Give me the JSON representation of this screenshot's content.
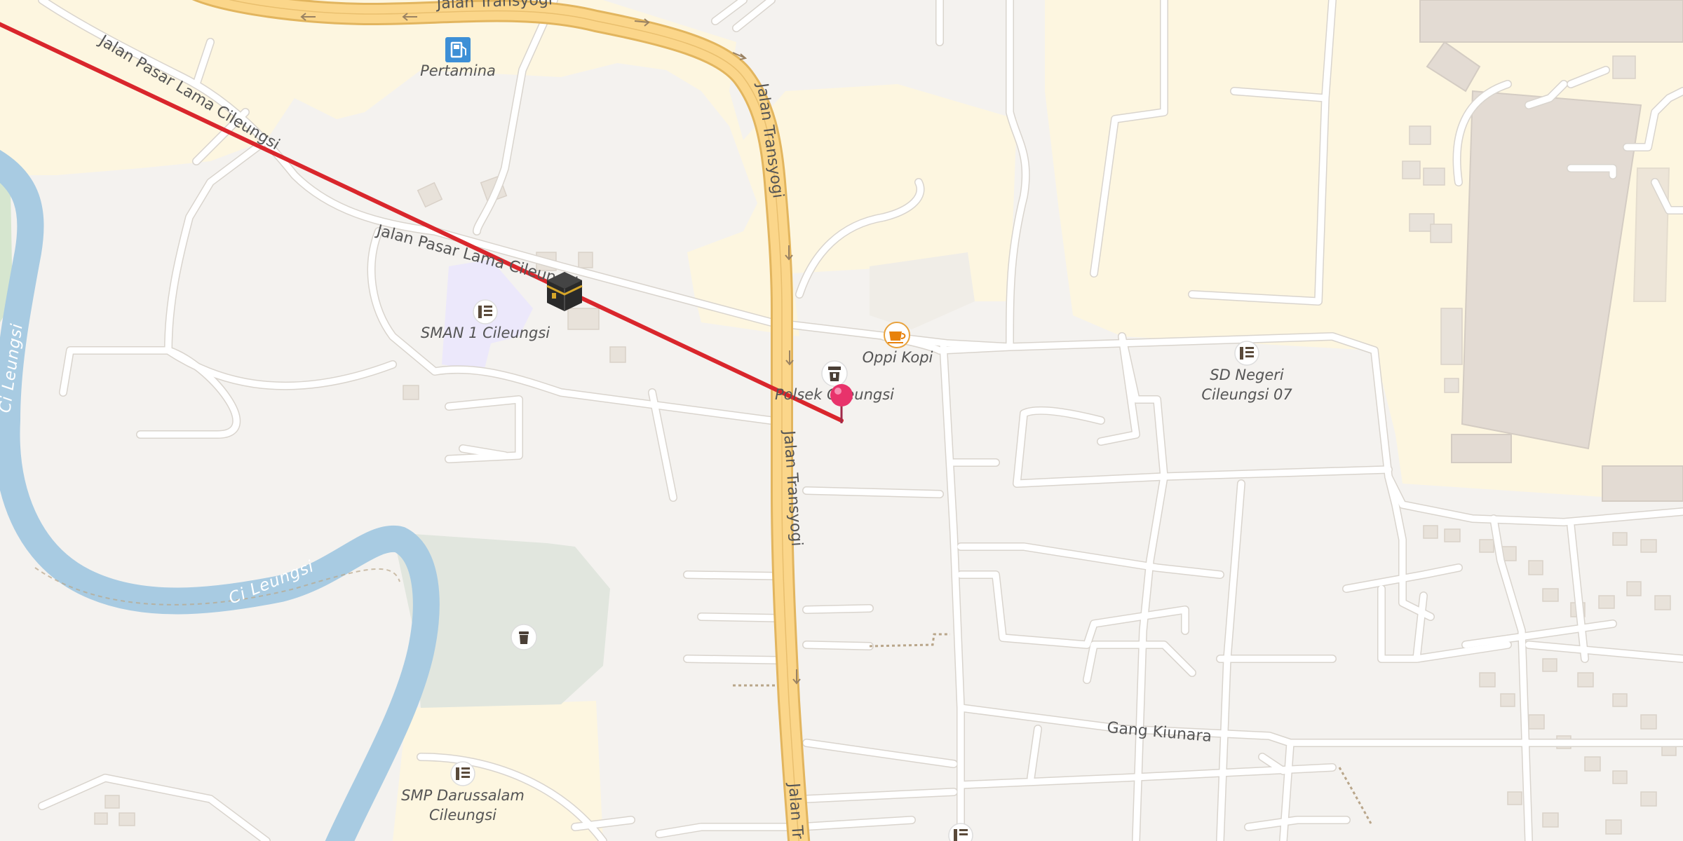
{
  "map": {
    "roads": {
      "jalan_transyogi_top": "Jalan Transyogi",
      "jalan_transyogi_east": "Jalan Transyogi",
      "jalan_transyogi_south": "Jalan Transyogi",
      "jalan_transyogi_bottom": "Jalan Tr",
      "jalan_pasar_lama_1": "Jalan Pasar Lama Cileungsi",
      "jalan_pasar_lama_2": "Jalan Pasar Lama Cileungsi",
      "gang_kiunara": "Gang Kiunara"
    },
    "waterways": {
      "ci_leungsi": "Ci Leungsi",
      "ci_leungsi_left": "Ci Leungsi"
    },
    "pois": {
      "pertamina": "Pertamina",
      "sman1": "SMAN 1 Cileungsi",
      "oppi_kopi": "Oppi Kopi",
      "polsek": "Polsek Cileungsi",
      "sd_negeri_line1": "SD Negeri",
      "sd_negeri_line2": "Cileungsi 07",
      "smp_line1": "SMP Darussalam",
      "smp_line2": "Cileungsi"
    },
    "colors": {
      "background": "#f4f2ef",
      "residential": "#fdf6e0",
      "water": "#a8cbe2",
      "park": "#e1e6de",
      "school": "#ece8fb",
      "main_road": "#fbd68a",
      "main_road_casing": "#e2b55e",
      "minor_road": "#ffffff",
      "route_line": "#d9262c",
      "pin": "#e8336b"
    },
    "icons": {
      "fuel": "fuel-station-icon",
      "school": "school-icon",
      "cafe": "cafe-icon",
      "police": "police-icon",
      "cemetery": "cemetery-icon",
      "mosque": "kaaba-icon",
      "pin": "location-pin-icon"
    }
  }
}
